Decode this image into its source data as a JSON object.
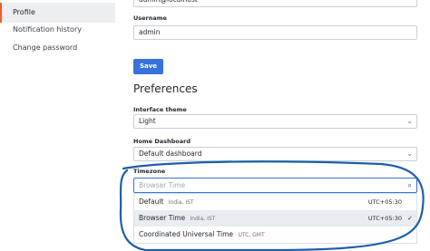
{
  "sidebar": {
    "items": [
      {
        "label": "Profile",
        "active": true
      },
      {
        "label": "Notification history",
        "active": false
      },
      {
        "label": "Change password",
        "active": false
      }
    ]
  },
  "profile": {
    "email_value": "admin@localhost",
    "username_label": "Username",
    "username_value": "admin",
    "save_label": "Save"
  },
  "preferences": {
    "title": "Preferences",
    "theme_label": "Interface theme",
    "theme_value": "Light",
    "dashboard_label": "Home Dashboard",
    "dashboard_value": "Default dashboard",
    "timezone_label": "Timezone",
    "timezone_placeholder": "Browser Time",
    "timezone_options": [
      {
        "name": "Default",
        "desc": "India, IST",
        "offset": "UTC+05:30",
        "selected": false
      },
      {
        "name": "Browser Time",
        "desc": "India, IST",
        "offset": "UTC+05:30",
        "selected": true
      },
      {
        "name": "Coordinated Universal Time",
        "desc": "UTC, GMT",
        "offset": "",
        "selected": false
      }
    ]
  },
  "colors": {
    "accent": "#3871dc",
    "active_marker": "#f05a28",
    "annotation_stroke": "#1f5fa8"
  },
  "icons": {
    "dropdown": "chevron-down-icon",
    "search": "search-icon",
    "selected": "check-icon"
  }
}
